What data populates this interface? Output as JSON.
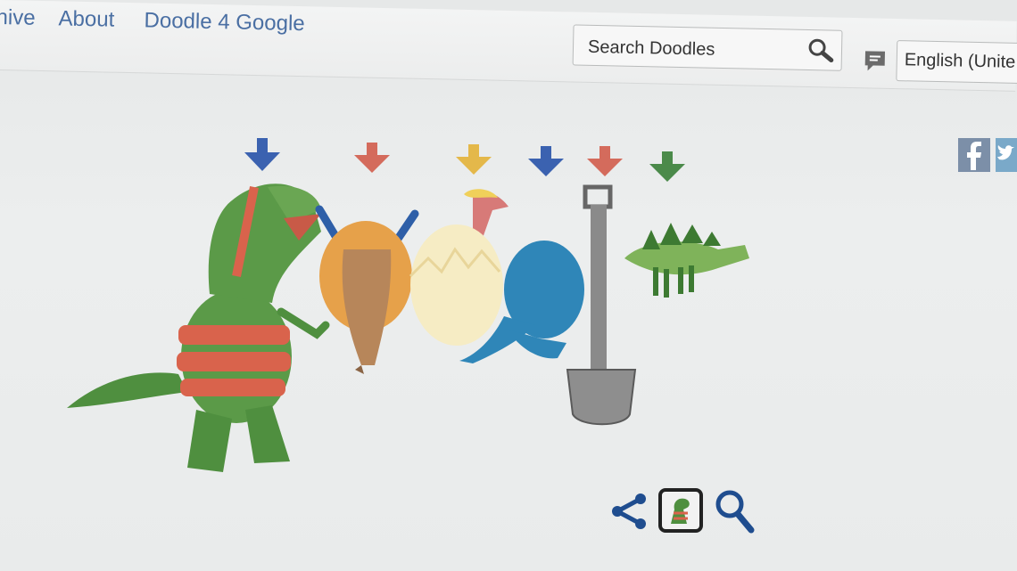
{
  "nav": {
    "archive_label": "hive",
    "about_label": "About",
    "doodle4google_label": "Doodle 4 Google"
  },
  "search": {
    "placeholder": "Search Doodles"
  },
  "language": {
    "selected": "English (Unite"
  },
  "icons": {
    "search": "search-icon",
    "feedback": "feedback-icon",
    "facebook": "facebook-icon",
    "twitter": "twitter-icon",
    "share": "share-icon",
    "dino_thumbnail": "dinosaur-thumbnail-icon",
    "zoom": "magnifier-icon"
  },
  "colors": {
    "link": "#4a6fa3",
    "arrow_blue": "#3b62b0",
    "arrow_red": "#d46b5c",
    "arrow_yellow": "#e4b84a",
    "arrow_green": "#4b8a4a",
    "control_blue": "#1f4d8f"
  }
}
